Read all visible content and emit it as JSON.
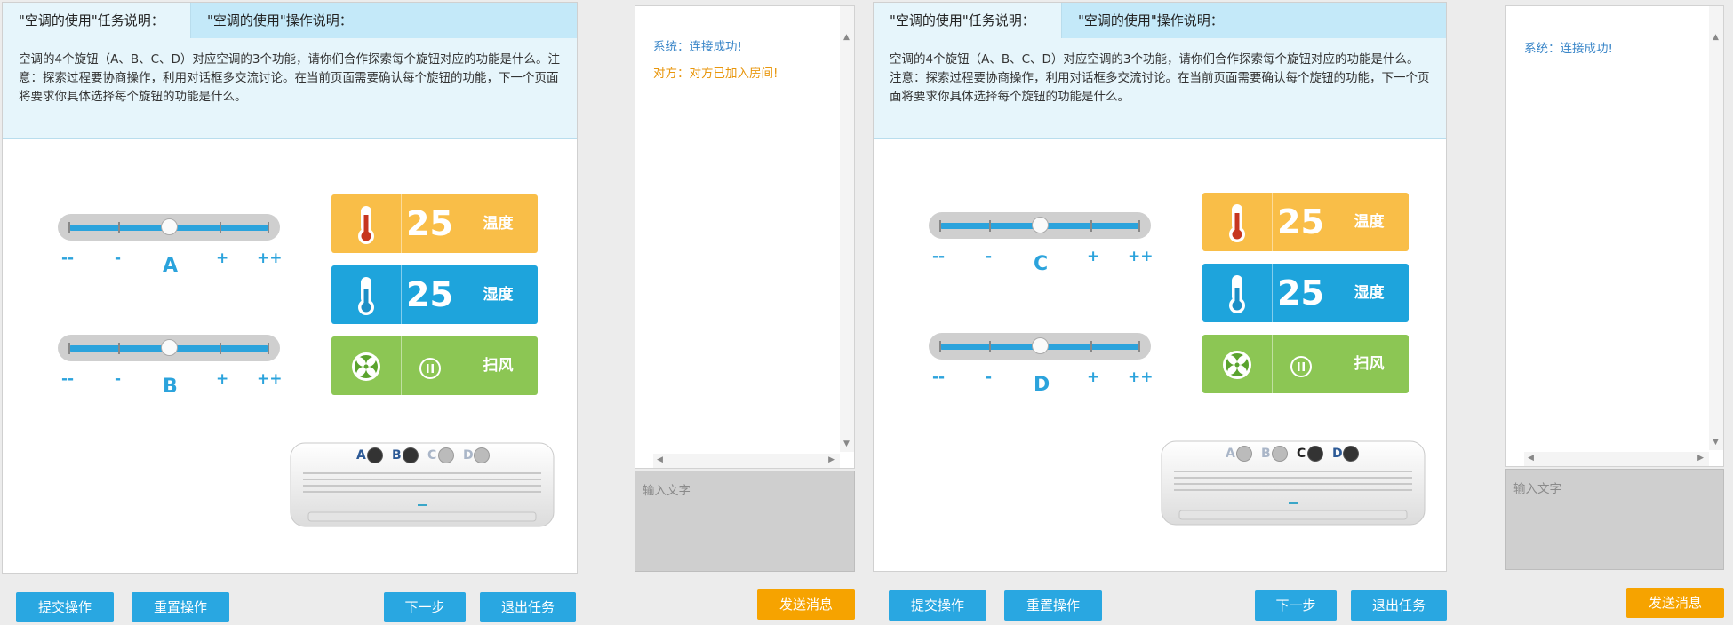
{
  "left": {
    "tabs": [
      "\"空调的使用\"任务说明：",
      "\"空调的使用\"操作说明："
    ],
    "description": "空调的4个旋钮（A、B、C、D）对应空调的3个功能，请你们合作探索每个旋钮对应的功能是什么。注意：探索过程要协商操作，利用对话框多交流讨论。在当前页面需要确认每个旋钮的功能，下一个页面将要求你具体选择每个旋钮的功能是什么。",
    "sliders": [
      {
        "letter": "A",
        "level": 0.5,
        "labels": [
          "--",
          "-",
          "+",
          "++"
        ]
      },
      {
        "letter": "B",
        "level": 0.5,
        "labels": [
          "--",
          "-",
          "+",
          "++"
        ]
      }
    ],
    "panels": [
      {
        "icon": "thermometer-red-icon",
        "value": "25",
        "label": "温度",
        "color": "#f9be48"
      },
      {
        "icon": "thermometer-blue-icon",
        "value": "25",
        "label": "湿度",
        "color": "#1ea4dc"
      },
      {
        "icon": "fan-icon",
        "second_icon": "pause-icon",
        "label": "扫风",
        "color": "#8cc654"
      }
    ],
    "ac_knobs": [
      {
        "letter": "A",
        "active": true
      },
      {
        "letter": "B",
        "active": true
      },
      {
        "letter": "C",
        "active": false
      },
      {
        "letter": "D",
        "active": false
      }
    ],
    "buttons": {
      "submit": "提交操作",
      "reset": "重置操作",
      "next": "下一步",
      "exit": "退出任务"
    }
  },
  "left_chat": {
    "messages": [
      {
        "text": "系统：连接成功!",
        "color": "#3a86c8"
      },
      {
        "text": "对方：对方已加入房间!",
        "color": "#e8960c"
      }
    ],
    "input_placeholder": "输入文字",
    "send": "发送消息"
  },
  "right": {
    "tabs": [
      "\"空调的使用\"任务说明：",
      "\"空调的使用\"操作说明："
    ],
    "description": "空调的4个旋钮（A、B、C、D）对应空调的3个功能，请你们合作探索每个旋钮对应的功能是什么。注意：探索过程要协商操作，利用对话框多交流讨论。在当前页面需要确认每个旋钮的功能，下一个页面将要求你具体选择每个旋钮的功能是什么。",
    "sliders": [
      {
        "letter": "C",
        "level": 0.5,
        "labels": [
          "--",
          "-",
          "+",
          "++"
        ]
      },
      {
        "letter": "D",
        "level": 0.5,
        "labels": [
          "--",
          "-",
          "+",
          "++"
        ]
      }
    ],
    "panels": [
      {
        "icon": "thermometer-red-icon",
        "value": "25",
        "label": "温度",
        "color": "#f9be48"
      },
      {
        "icon": "thermometer-blue-icon",
        "value": "25",
        "label": "湿度",
        "color": "#1ea4dc"
      },
      {
        "icon": "fan-icon",
        "second_icon": "pause-icon",
        "label": "扫风",
        "color": "#8cc654"
      }
    ],
    "ac_knobs": [
      {
        "letter": "A",
        "active": false
      },
      {
        "letter": "B",
        "active": false
      },
      {
        "letter": "C",
        "active": true
      },
      {
        "letter": "D",
        "active": true
      }
    ],
    "buttons": {
      "submit": "提交操作",
      "reset": "重置操作",
      "next": "下一步",
      "exit": "退出任务"
    }
  },
  "right_chat": {
    "messages": [
      {
        "text": "系统：连接成功!",
        "color": "#3a86c8"
      }
    ],
    "input_placeholder": "输入文字",
    "send": "发送消息"
  }
}
